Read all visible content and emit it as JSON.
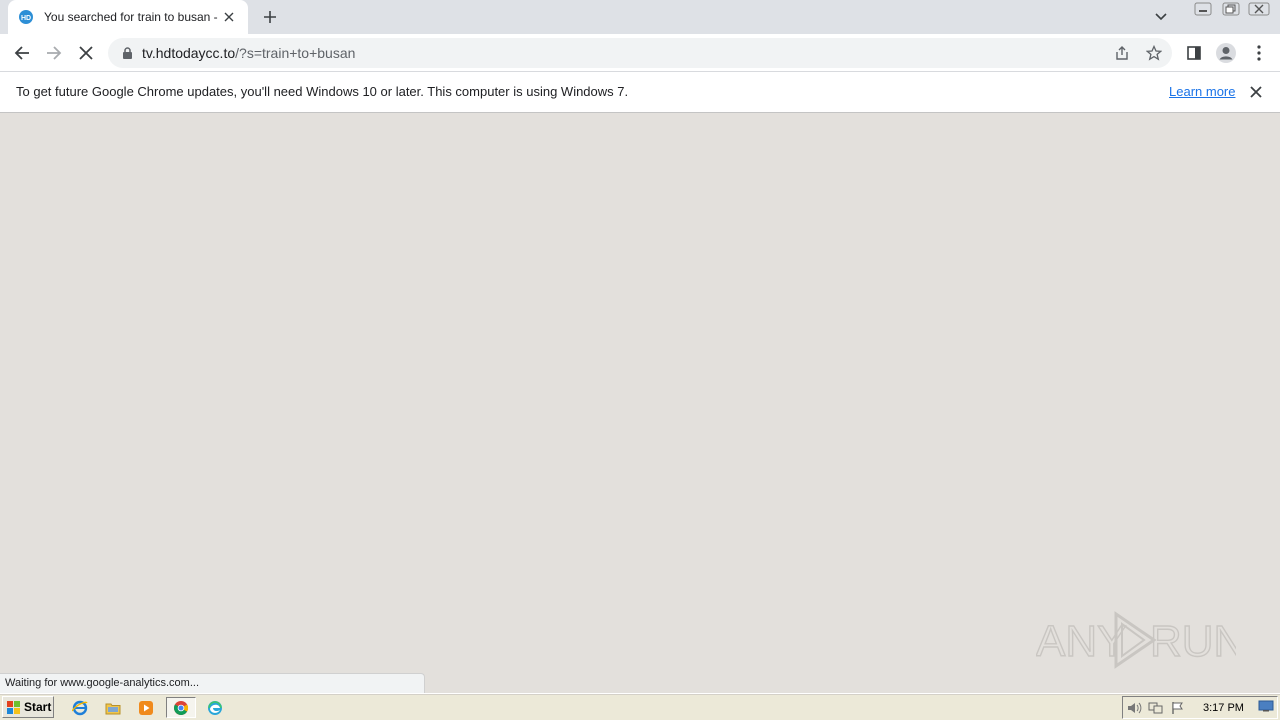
{
  "browser": {
    "tab": {
      "title": "You searched for train to busan - HD",
      "favicon": "hdtoday-favicon"
    },
    "address_bar": {
      "host": "tv.hdtodaycc.to",
      "path": "/?s=train+to+busan"
    },
    "infobar": {
      "message": "To get future Google Chrome updates, you'll need Windows 10 or later. This computer is using Windows 7.",
      "link": "Learn more"
    },
    "status_text": "Waiting for www.google-analytics.com..."
  },
  "watermark": {
    "left_text": "ANY",
    "right_text": "RUN"
  },
  "taskbar": {
    "start_label": "Start",
    "pinned": [
      "internet-explorer-icon",
      "folder-icon",
      "media-player-icon",
      "chrome-icon",
      "edge-icon"
    ],
    "clock": "3:17 PM"
  },
  "colors": {
    "accent_link": "#1a73e8",
    "content_bg": "#e3e0dc",
    "tabstrip_bg": "#dee1e6",
    "taskbar_bg": "#ece9d8"
  }
}
